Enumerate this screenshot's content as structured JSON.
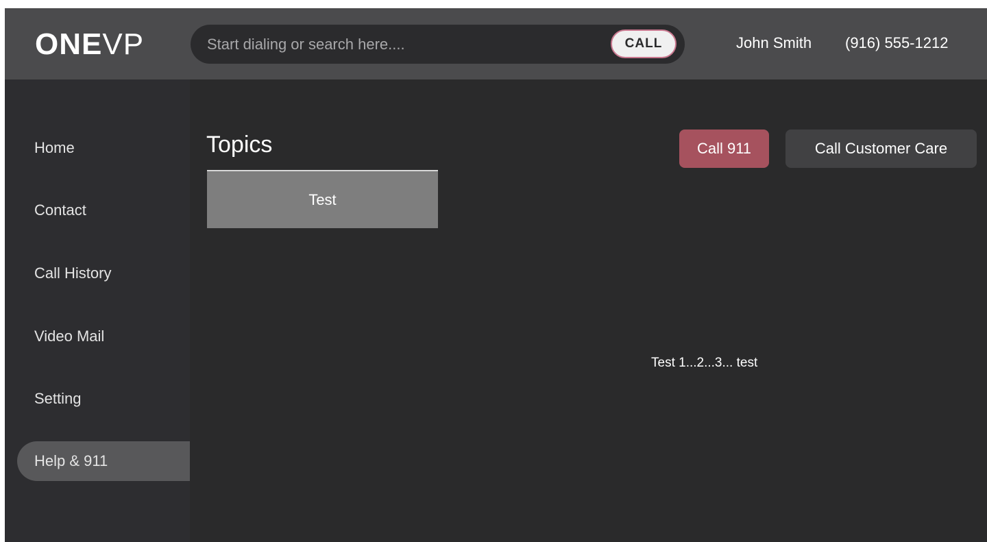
{
  "header": {
    "logo_bold": "ONE",
    "logo_thin": "VP",
    "search": {
      "placeholder": "Start dialing or search here...."
    },
    "call_label": "CALL",
    "user_name": "John Smith",
    "user_phone": "(916) 555-1212"
  },
  "sidebar": {
    "items": [
      {
        "label": "Home"
      },
      {
        "label": "Contact"
      },
      {
        "label": "Call History"
      },
      {
        "label": "Video Mail"
      },
      {
        "label": "Setting"
      },
      {
        "label": "Help & 911",
        "active": true
      }
    ]
  },
  "main": {
    "title": "Topics",
    "topics": [
      {
        "label": "Test"
      }
    ],
    "call_911_label": "Call 911",
    "call_care_label": "Call Customer Care",
    "content_text": "Test 1...2...3... test"
  },
  "colors": {
    "header_bg": "#4b4b4d",
    "body_bg": "#2a2a2b",
    "sidebar_bg": "#2d2d30",
    "active_nav_bg": "#58585a",
    "call_911_bg": "#a6525e",
    "call_care_bg": "#414143",
    "topic_bg": "#7e7e7e",
    "call_button_border": "#c9788f"
  }
}
